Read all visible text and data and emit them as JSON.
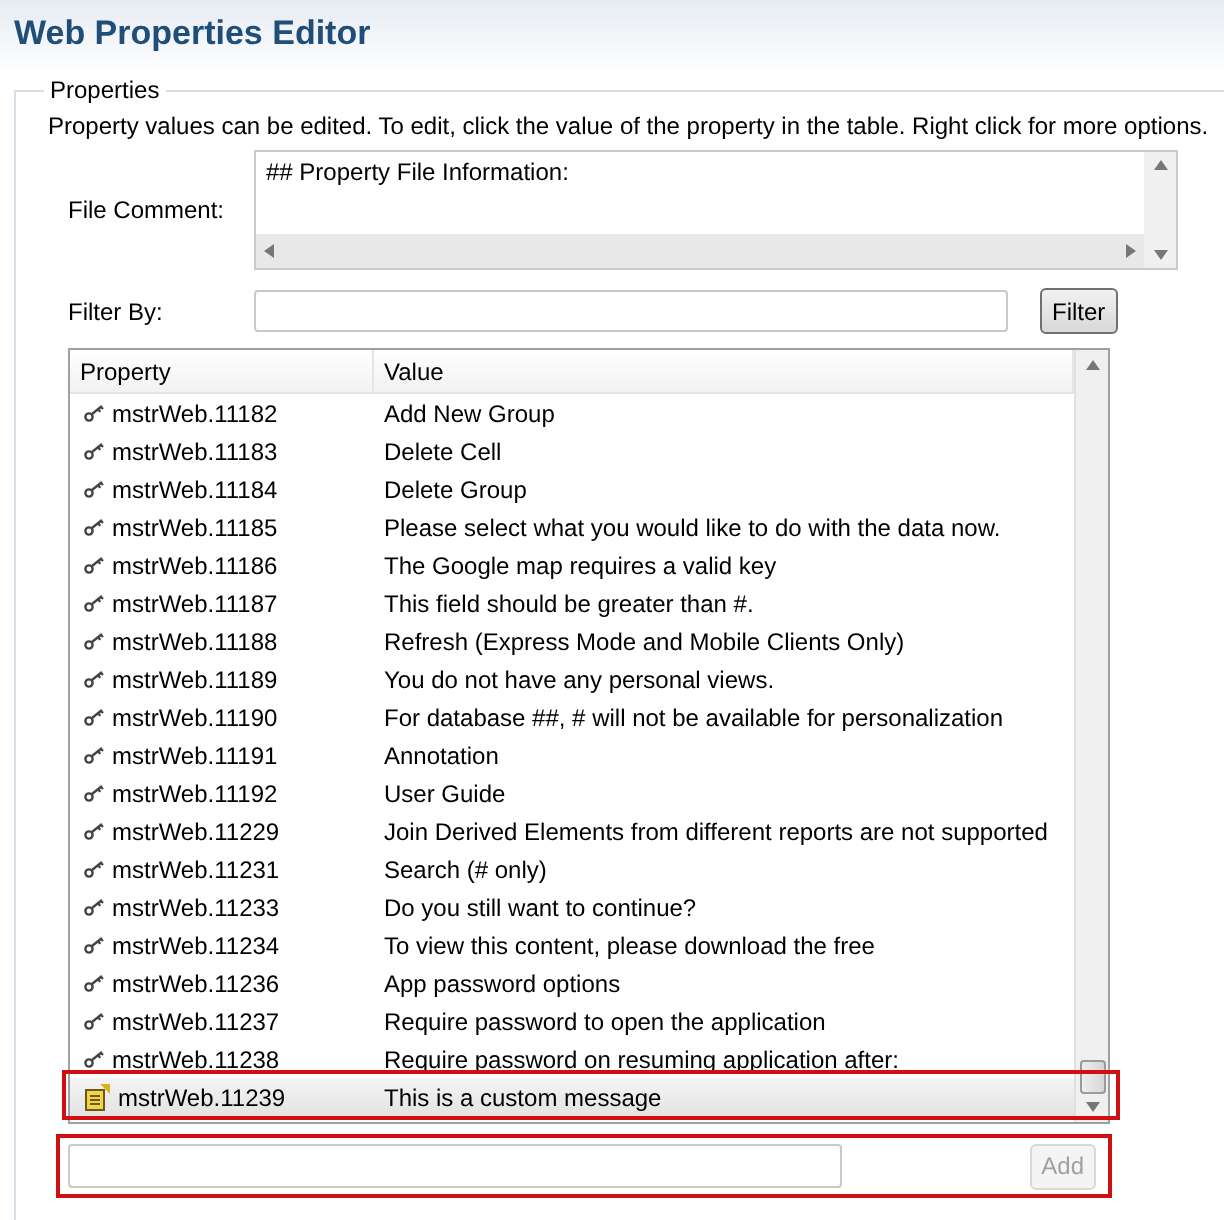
{
  "title": "Web Properties Editor",
  "group": {
    "legend": "Properties",
    "description": "Property values can be edited. To edit, click the value of the property in the table. Right click for more options."
  },
  "file_comment": {
    "label": "File Comment:",
    "value": "## Property File Information:"
  },
  "filter": {
    "label": "Filter By:",
    "button": "Filter"
  },
  "table": {
    "columns": [
      "Property",
      "Value"
    ],
    "rows": [
      {
        "kind": "default",
        "property": "mstrWeb.11182",
        "value": "Add New Group",
        "selected": false
      },
      {
        "kind": "default",
        "property": "mstrWeb.11183",
        "value": "Delete Cell",
        "selected": false
      },
      {
        "kind": "default",
        "property": "mstrWeb.11184",
        "value": "Delete Group",
        "selected": false
      },
      {
        "kind": "default",
        "property": "mstrWeb.11185",
        "value": "Please select what you would like to do with the data now.",
        "selected": false
      },
      {
        "kind": "default",
        "property": "mstrWeb.11186",
        "value": "The Google map requires a valid key",
        "selected": false
      },
      {
        "kind": "default",
        "property": "mstrWeb.11187",
        "value": "This field should be greater than #.",
        "selected": false
      },
      {
        "kind": "default",
        "property": "mstrWeb.11188",
        "value": "Refresh (Express Mode and Mobile Clients Only)",
        "selected": false
      },
      {
        "kind": "default",
        "property": "mstrWeb.11189",
        "value": "You do not have any personal views.",
        "selected": false
      },
      {
        "kind": "default",
        "property": "mstrWeb.11190",
        "value": "For database ##, # will not be available for personalization",
        "selected": false
      },
      {
        "kind": "default",
        "property": "mstrWeb.11191",
        "value": "Annotation",
        "selected": false
      },
      {
        "kind": "default",
        "property": "mstrWeb.11192",
        "value": "User Guide",
        "selected": false
      },
      {
        "kind": "default",
        "property": "mstrWeb.11229",
        "value": "Join Derived Elements from different reports are not supported",
        "selected": false
      },
      {
        "kind": "default",
        "property": "mstrWeb.11231",
        "value": "Search (# only)",
        "selected": false
      },
      {
        "kind": "default",
        "property": "mstrWeb.11233",
        "value": "Do you still want to continue?",
        "selected": false
      },
      {
        "kind": "default",
        "property": "mstrWeb.11234",
        "value": "To view this content, please download the free",
        "selected": false
      },
      {
        "kind": "default",
        "property": "mstrWeb.11236",
        "value": "App password options",
        "selected": false
      },
      {
        "kind": "default",
        "property": "mstrWeb.11237",
        "value": "Require password to open the application",
        "selected": false
      },
      {
        "kind": "default",
        "property": "mstrWeb.11238",
        "value": "Require password on resuming application after:",
        "selected": false
      },
      {
        "kind": "custom",
        "property": "mstrWeb.11239",
        "value": "This is a custom message",
        "selected": true
      }
    ]
  },
  "add": {
    "button": "Add",
    "disabled": true
  }
}
